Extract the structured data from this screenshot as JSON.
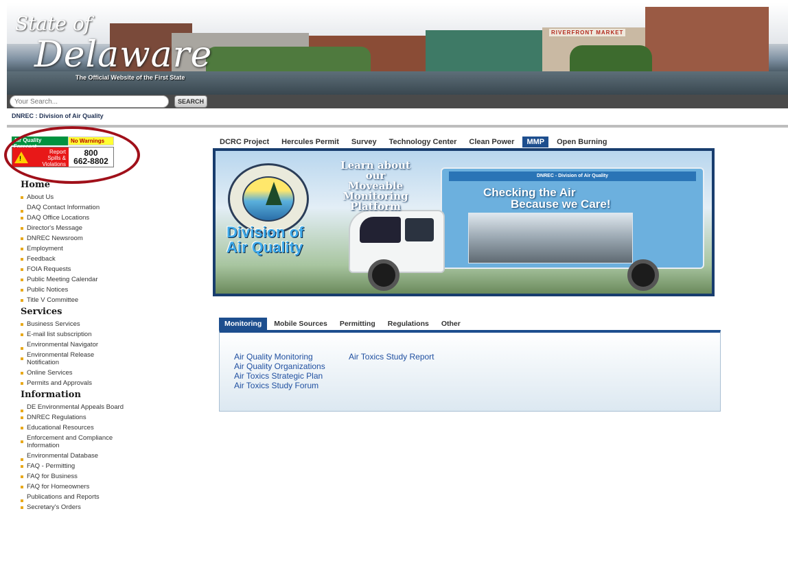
{
  "header": {
    "logo_state": "State of",
    "logo_delaware": "Delaware",
    "tagline": "The Official Website of the First State",
    "sign_text": "RIVERFRONT MARKET"
  },
  "search": {
    "placeholder": "Your Search...",
    "button_label": "SEARCH"
  },
  "breadcrumb": "DNREC : Division of Air Quality",
  "aq_widget": {
    "forecast_label": "Air Quality Forecast",
    "status": "No Warnings",
    "report_line1": "Report",
    "report_line2": "Spills &",
    "report_line3": "Violations",
    "phone_line1": "800",
    "phone_line2": "662-8802"
  },
  "left_nav": {
    "home_heading": "Home",
    "home_items": [
      "About Us",
      "DAQ Contact Information",
      "DAQ Office Locations",
      "Director's Message",
      "DNREC Newsroom",
      "Employment",
      "Feedback",
      "FOIA Requests",
      "Public Meeting Calendar",
      "Public Notices",
      "Title V Committee"
    ],
    "services_heading": "Services",
    "services_items": [
      "Business Services",
      "E-mail list subscription",
      "Environmental Navigator",
      "Environmental Release Notification",
      "Online Services",
      "Permits and Approvals"
    ],
    "information_heading": "Information",
    "information_items": [
      "DE Environmental Appeals Board",
      "DNREC Regulations",
      "Educational Resources",
      "Enforcement and Compliance Information",
      "Environmental Database",
      "FAQ - Permitting",
      "FAQ for Business",
      "FAQ for Homeowners",
      "Publications and Reports",
      "Secretary's Orders"
    ]
  },
  "top_tabs": [
    {
      "label": "DCRC Project",
      "active": false
    },
    {
      "label": "Hercules Permit",
      "active": false
    },
    {
      "label": "Survey",
      "active": false
    },
    {
      "label": "Technology Center",
      "active": false
    },
    {
      "label": "Clean Power",
      "active": false
    },
    {
      "label": "MMP",
      "active": true
    },
    {
      "label": "Open Burning",
      "active": false
    }
  ],
  "hero": {
    "learn_line1": "Learn about",
    "learn_line2": "our",
    "learn_line3": "Moveable",
    "learn_line4": "Monitoring",
    "learn_line5": "Platform",
    "division_line1": "Division of",
    "division_line2": "Air Quality",
    "truck_header": "DNREC - Division of Air Quality",
    "truck_line1": "Checking the Air",
    "truck_line2": "Because we Care!"
  },
  "sub_tabs": [
    {
      "label": "Monitoring",
      "active": true
    },
    {
      "label": "Mobile Sources",
      "active": false
    },
    {
      "label": "Permitting",
      "active": false
    },
    {
      "label": "Regulations",
      "active": false
    },
    {
      "label": "Other",
      "active": false
    }
  ],
  "monitoring_links": {
    "col1": [
      "Air Quality Monitoring",
      "Air Quality Organizations",
      "Air Toxics Strategic Plan",
      "Air Toxics Study Forum"
    ],
    "col2": [
      "Air Toxics Study Report"
    ]
  },
  "colors": {
    "tab_active": "#1d4e8e",
    "link": "#1f4fa0",
    "bullet": "#e8a91c",
    "highlight": "#a0101a"
  }
}
